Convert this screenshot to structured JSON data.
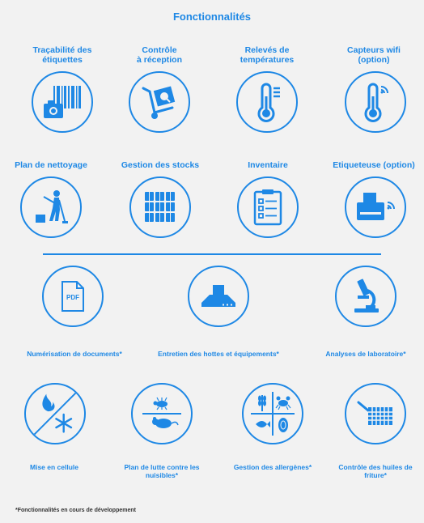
{
  "page": {
    "title": "Fonctionnalités",
    "accent": "#1e88e5"
  },
  "row1": [
    {
      "label": "Traçabilité des\nétiquettes",
      "icon": "barcode-camera-icon"
    },
    {
      "label": "Contrôle\nà réception",
      "icon": "hand-truck-icon"
    },
    {
      "label": "Relevés de\ntempératures",
      "icon": "thermometer-icon"
    },
    {
      "label": "Capteurs wifi\n(option)",
      "icon": "wifi-thermometer-icon"
    }
  ],
  "row2": [
    {
      "label": "Plan de nettoyage",
      "icon": "mopping-person-icon"
    },
    {
      "label": "Gestion des stocks",
      "icon": "boxes-icon"
    },
    {
      "label": "Inventaire",
      "icon": "checklist-clipboard-icon"
    },
    {
      "label": "Etiqueteuse (option)",
      "icon": "label-printer-icon"
    }
  ],
  "row3": [
    {
      "label": "Numérisation de documents*",
      "icon": "pdf-document-icon"
    },
    {
      "label": "Entretien des hottes et équipements*",
      "icon": "kitchen-hood-icon"
    },
    {
      "label": "Analyses de laboratoire*",
      "icon": "microscope-icon"
    }
  ],
  "row4": [
    {
      "label": "Mise en cellule",
      "icon": "flame-snowflake-icon"
    },
    {
      "label": "Plan de lutte contre les\nnuisibles*",
      "icon": "pests-icon"
    },
    {
      "label": "Gestion des allergènes*",
      "icon": "allergens-icon"
    },
    {
      "label": "Contrôle des huiles de\nfriture*",
      "icon": "fryer-basket-icon"
    }
  ],
  "footnote": "*Fonctionnalités en cours de développement"
}
